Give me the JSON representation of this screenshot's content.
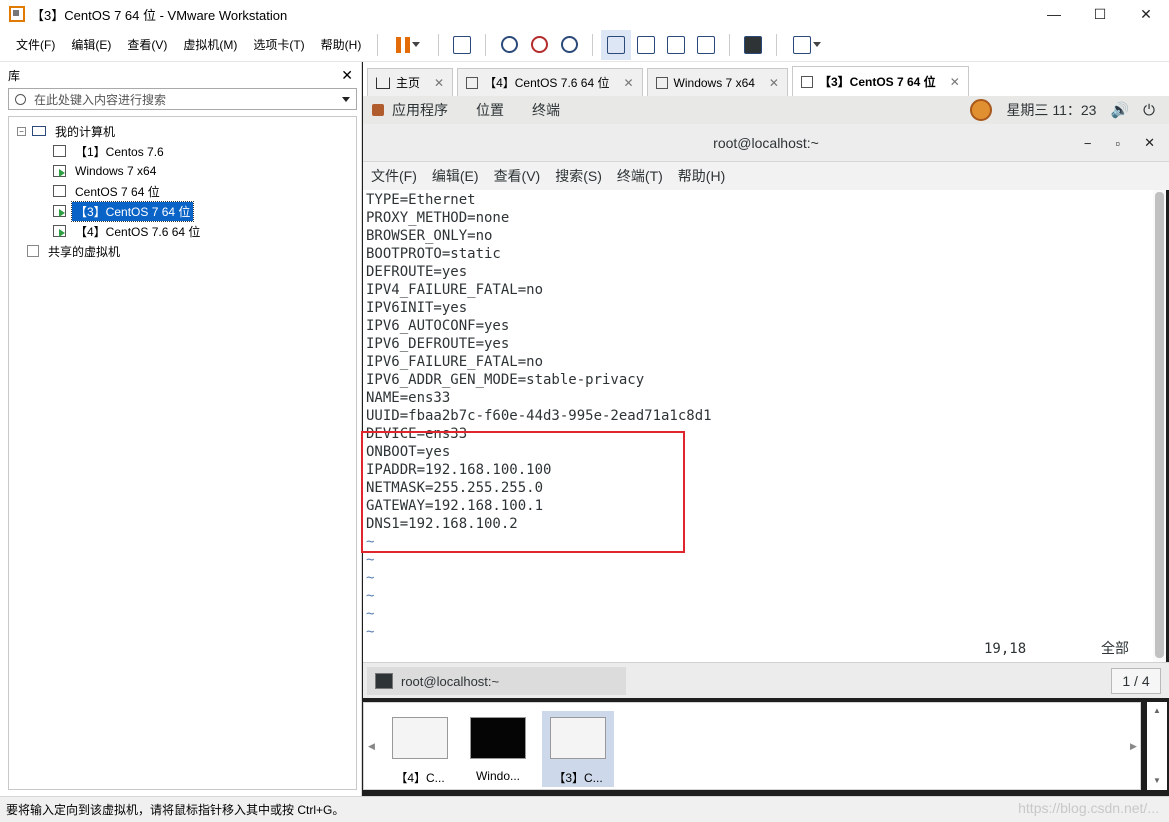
{
  "window": {
    "title": "【3】CentOS 7 64 位 - VMware Workstation",
    "minimize_glyph": "—",
    "maximize_glyph": "☐",
    "close_glyph": "✕"
  },
  "menu": {
    "items": [
      "文件(F)",
      "编辑(E)",
      "查看(V)",
      "虚拟机(M)",
      "选项卡(T)",
      "帮助(H)"
    ]
  },
  "library": {
    "title": "库",
    "close_glyph": "✕",
    "search_placeholder": "在此处键入内容进行搜索",
    "tree": {
      "root_label": "我的计算机",
      "expander": "−",
      "items": [
        {
          "label": "【1】Centos 7.6",
          "running": false
        },
        {
          "label": "Windows 7 x64",
          "running": true
        },
        {
          "label": "CentOS 7 64 位",
          "running": false
        },
        {
          "label": "【3】CentOS 7 64 位",
          "running": true,
          "selected": true
        },
        {
          "label": "【4】CentOS 7.6 64 位",
          "running": true
        }
      ],
      "shared_label": "共享的虚拟机"
    }
  },
  "tabs": [
    {
      "label": "主页",
      "icon": "home-icon",
      "active": false
    },
    {
      "label": "【4】CentOS 7.6 64 位",
      "icon": "vm-icon",
      "active": false
    },
    {
      "label": "Windows 7 x64",
      "icon": "vm-icon",
      "active": false
    },
    {
      "label": "【3】CentOS 7 64 位",
      "icon": "vm-icon",
      "active": true
    }
  ],
  "tab_close_glyph": "✕",
  "gnome": {
    "applications": "应用程序",
    "places": "位置",
    "terminal": "终端",
    "clock": "星期三 11：23",
    "volume_glyph": "🔊",
    "power_glyph": "⏻"
  },
  "terminal": {
    "title": "root@localhost:~",
    "ctrl_min": "−",
    "ctrl_max": "▫",
    "ctrl_close": "✕",
    "menu": [
      "文件(F)",
      "编辑(E)",
      "查看(V)",
      "搜索(S)",
      "终端(T)",
      "帮助(H)"
    ],
    "lines": [
      "TYPE=Ethernet",
      "PROXY_METHOD=none",
      "BROWSER_ONLY=no",
      "BOOTPROTO=static",
      "DEFROUTE=yes",
      "IPV4_FAILURE_FATAL=no",
      "IPV6INIT=yes",
      "IPV6_AUTOCONF=yes",
      "IPV6_DEFROUTE=yes",
      "IPV6_FAILURE_FATAL=no",
      "IPV6_ADDR_GEN_MODE=stable-privacy",
      "NAME=ens33",
      "UUID=fbaa2b7c-f60e-44d3-995e-2ead71a1c8d1",
      "DEVICE=ens33",
      "ONBOOT=yes",
      "IPADDR=192.168.100.100",
      "NETMASK=255.255.255.0",
      "GATEWAY=192.168.100.1",
      "DNS1=192.168.100.2"
    ],
    "tilde_lines": [
      "~",
      "~",
      "~",
      "~",
      "~",
      "~"
    ],
    "cursor_pos": "19,18",
    "view_pos": "全部"
  },
  "taskbar": {
    "item": "root@localhost:~",
    "pager": "1 / 4"
  },
  "thumbnails": [
    {
      "label": "【4】C...",
      "dark": false,
      "selected": false
    },
    {
      "label": "Windo...",
      "dark": true,
      "selected": false
    },
    {
      "label": "【3】C...",
      "dark": false,
      "selected": true
    }
  ],
  "statusbar": {
    "text": "要将输入定向到该虚拟机，请将鼠标指针移入其中或按 Ctrl+G。"
  },
  "watermark": "https://blog.csdn.net/..."
}
